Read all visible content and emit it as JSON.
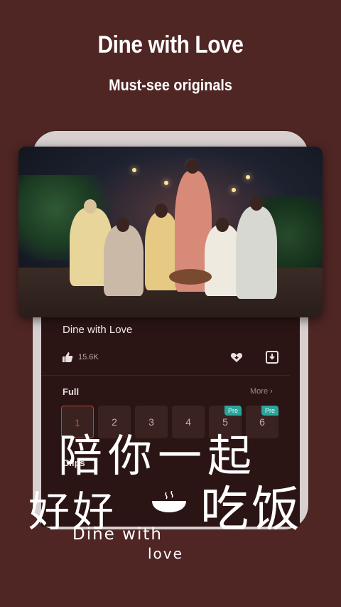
{
  "promo": {
    "headline": "Dine with Love",
    "subheadline": "Must-see originals"
  },
  "card": {
    "title": "Dine with Love",
    "likes": "15.6K",
    "icons": {
      "like": "thumbs-up-icon",
      "favorite": "heart-icon",
      "download": "download-icon"
    }
  },
  "episodes": {
    "section_label": "Full",
    "more_label": "More",
    "items": [
      {
        "number": "1",
        "active": true,
        "tag": ""
      },
      {
        "number": "2",
        "active": false,
        "tag": ""
      },
      {
        "number": "3",
        "active": false,
        "tag": ""
      },
      {
        "number": "4",
        "active": false,
        "tag": ""
      },
      {
        "number": "5",
        "active": false,
        "tag": "Pre"
      },
      {
        "number": "6",
        "active": false,
        "tag": "Pre"
      }
    ]
  },
  "clips": {
    "section_label": "Clips"
  },
  "logo": {
    "cjk_line1": "陪你一起",
    "cjk_line2_left": "好好",
    "cjk_line2_right": "吃饭",
    "english_line1": "Dine with",
    "english_line2": "love"
  },
  "colors": {
    "background": "#4f2624",
    "accent_active": "#d34a37",
    "pre_tag": "#2aa59b"
  }
}
